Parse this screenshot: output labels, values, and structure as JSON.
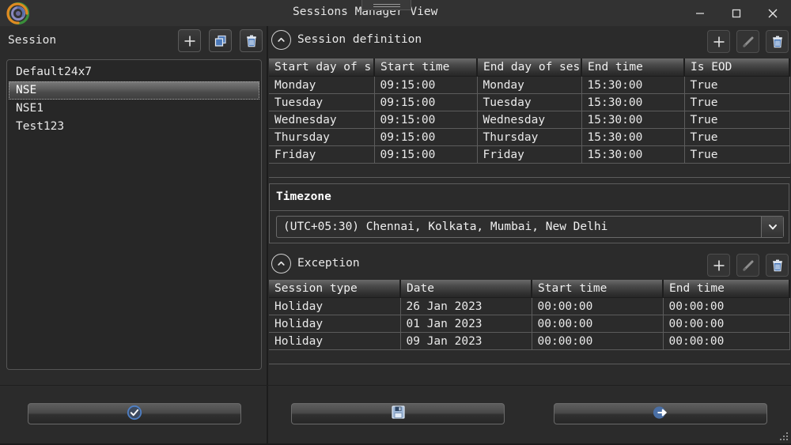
{
  "window": {
    "title": "Sessions Manager View",
    "logo_icon": "spiral-logo-icon",
    "minimize_label": "–",
    "maximize_label": "□",
    "close_label": "✕"
  },
  "left_panel": {
    "label": "Session",
    "tools": [
      {
        "name": "add-session-button",
        "icon": "plus-icon"
      },
      {
        "name": "copy-session-button",
        "icon": "copy-icon"
      },
      {
        "name": "delete-session-button",
        "icon": "trash-icon"
      }
    ],
    "sessions": [
      {
        "label": "Default24x7",
        "selected": false
      },
      {
        "label": "NSE",
        "selected": true
      },
      {
        "label": "NSE1",
        "selected": false
      },
      {
        "label": "Test123",
        "selected": false
      }
    ]
  },
  "session_definition": {
    "title": "Session definition",
    "collapse_icon": "chevron-up-icon",
    "tools": [
      {
        "name": "add-definition-button",
        "icon": "plus-icon"
      },
      {
        "name": "edit-definition-button",
        "icon": "pencil-icon"
      },
      {
        "name": "delete-definition-button",
        "icon": "trash-icon"
      }
    ],
    "columns": [
      "Start day of s",
      "Start time",
      "End day of ses",
      "End time",
      "Is EOD"
    ],
    "rows": [
      [
        "Monday",
        "09:15:00",
        "Monday",
        "15:30:00",
        "True"
      ],
      [
        "Tuesday",
        "09:15:00",
        "Tuesday",
        "15:30:00",
        "True"
      ],
      [
        "Wednesday",
        "09:15:00",
        "Wednesday",
        "15:30:00",
        "True"
      ],
      [
        "Thursday",
        "09:15:00",
        "Thursday",
        "15:30:00",
        "True"
      ],
      [
        "Friday",
        "09:15:00",
        "Friday",
        "15:30:00",
        "True"
      ]
    ]
  },
  "timezone": {
    "title": "Timezone",
    "selected": "(UTC+05:30) Chennai, Kolkata, Mumbai, New Delhi",
    "dropdown_icon": "chevron-down-icon"
  },
  "exception": {
    "title": "Exception",
    "collapse_icon": "chevron-up-icon",
    "tools": [
      {
        "name": "add-exception-button",
        "icon": "plus-icon"
      },
      {
        "name": "edit-exception-button",
        "icon": "pencil-icon"
      },
      {
        "name": "delete-exception-button",
        "icon": "trash-icon"
      }
    ],
    "columns": [
      "Session type",
      "Date",
      "Start time",
      "End time"
    ],
    "rows": [
      [
        "Holiday",
        "26 Jan 2023",
        "00:00:00",
        "00:00:00"
      ],
      [
        "Holiday",
        "01 Jan 2023",
        "00:00:00",
        "00:00:00"
      ],
      [
        "Holiday",
        "09 Jan 2023",
        "00:00:00",
        "00:00:00"
      ]
    ]
  },
  "bottom_bar": {
    "buttons": [
      {
        "name": "ok-button",
        "icon": "check-circle-icon",
        "label": ""
      },
      {
        "name": "save-button",
        "icon": "floppy-disk-icon",
        "label": ""
      },
      {
        "name": "exit-button",
        "icon": "exit-icon",
        "label": ""
      }
    ]
  },
  "colors": {
    "background": "#2b2b2b",
    "titlebar": "#323232",
    "accent_blue": "#4a78b8",
    "text": "#e8e8e8",
    "border": "#5c5c5c"
  }
}
